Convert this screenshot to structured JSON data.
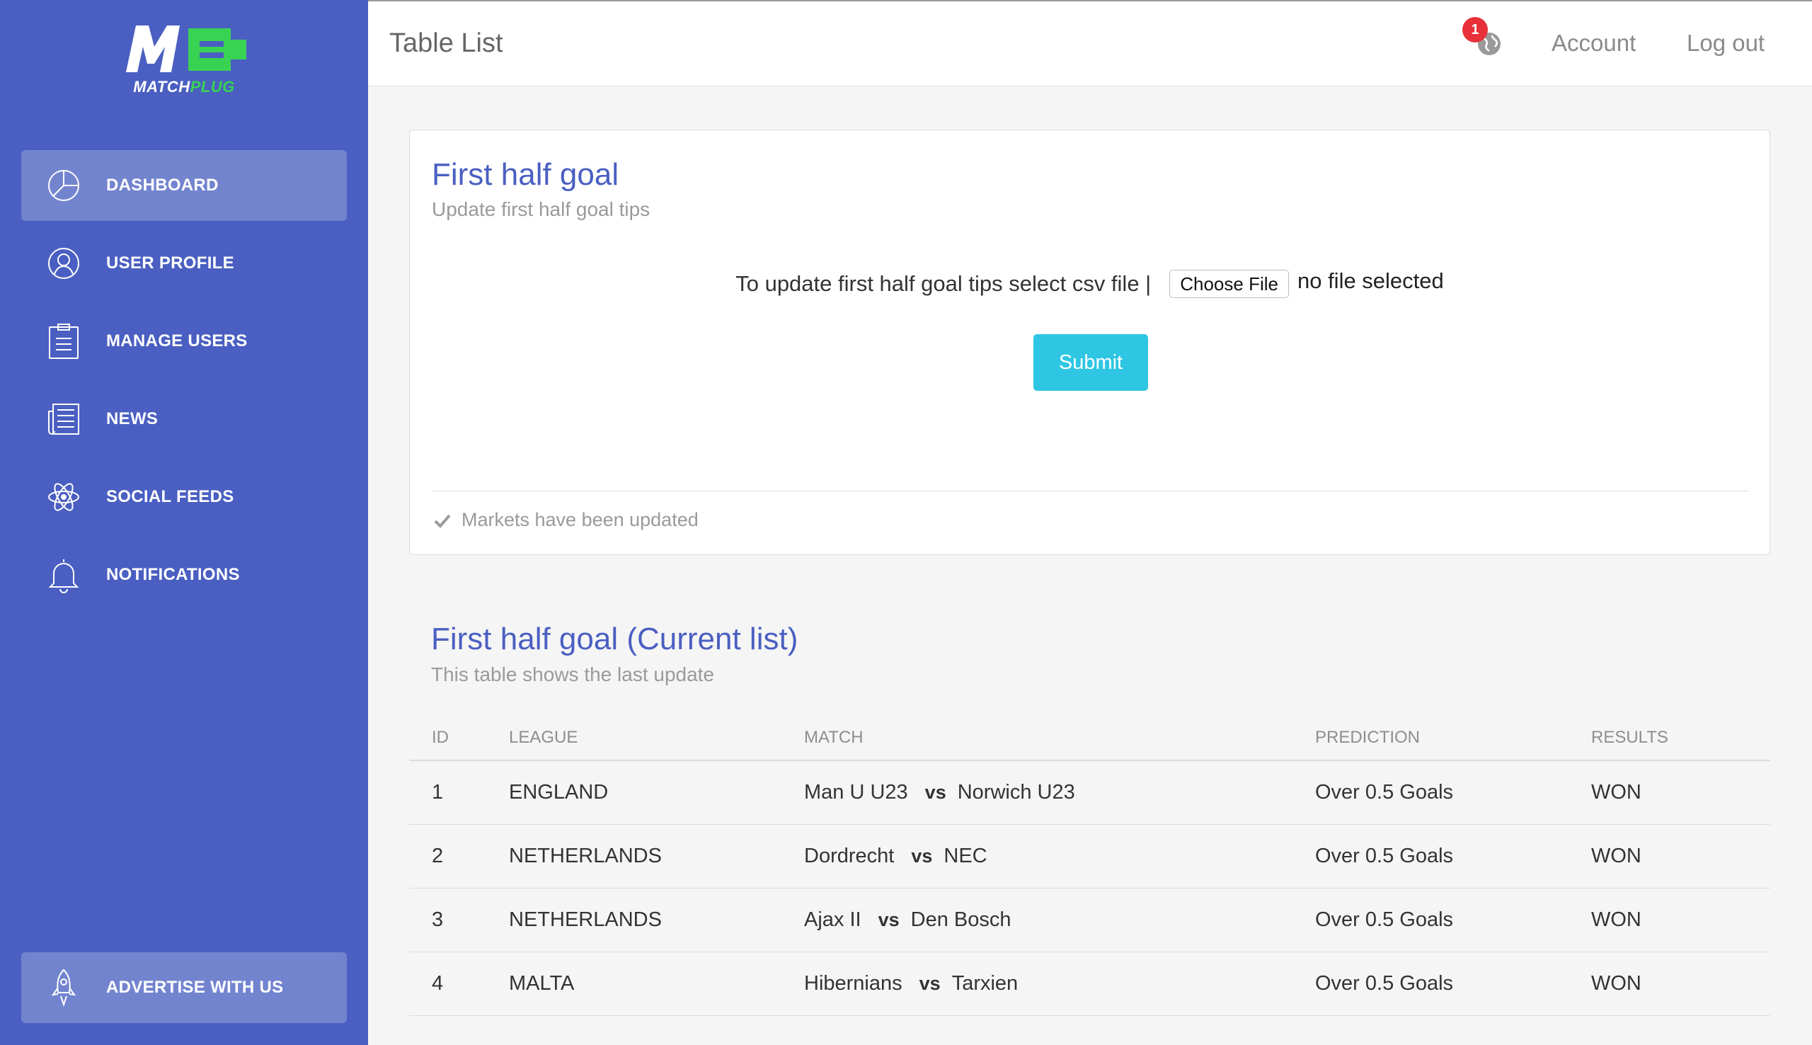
{
  "brand": {
    "logo_primary": "MATCH",
    "logo_secondary": "PLUG",
    "colors": {
      "sidebar": "#4a5fc1",
      "accent_green": "#39d353",
      "submit": "#2ec6e2",
      "badge": "#e8303a"
    }
  },
  "sidebar": {
    "items": [
      {
        "label": "DASHBOARD",
        "icon": "pie-chart-icon",
        "active": true
      },
      {
        "label": "USER PROFILE",
        "icon": "user-icon"
      },
      {
        "label": "MANAGE USERS",
        "icon": "clipboard-icon"
      },
      {
        "label": "NEWS",
        "icon": "newspaper-icon"
      },
      {
        "label": "SOCIAL FEEDS",
        "icon": "atom-icon"
      },
      {
        "label": "NOTIFICATIONS",
        "icon": "bell-icon"
      }
    ],
    "advertise": {
      "label": "ADVERTISE WITH US",
      "icon": "rocket-icon"
    }
  },
  "topbar": {
    "title": "Table List",
    "notification_count": "1",
    "account": "Account",
    "logout": "Log out"
  },
  "upload_card": {
    "title": "First half goal",
    "subtitle": "Update first half goal tips",
    "upload_label": "To update first half goal tips select csv file |",
    "choose_file": "Choose File",
    "file_status": "no file selected",
    "submit": "Submit",
    "footer": "Markets have been updated"
  },
  "table_section": {
    "title": "First half goal (Current list)",
    "subtitle": "This table shows the last update",
    "headers": {
      "id": "ID",
      "league": "LEAGUE",
      "match": "MATCH",
      "prediction": "PREDICTION",
      "results": "RESULTS"
    },
    "vs": "vs",
    "rows": [
      {
        "id": "1",
        "league": "ENGLAND",
        "home": "Man U U23",
        "away": "Norwich U23",
        "prediction": "Over 0.5 Goals",
        "result": "WON"
      },
      {
        "id": "2",
        "league": "NETHERLANDS",
        "home": "Dordrecht",
        "away": "NEC",
        "prediction": "Over 0.5 Goals",
        "result": "WON"
      },
      {
        "id": "3",
        "league": "NETHERLANDS",
        "home": "Ajax II",
        "away": "Den Bosch",
        "prediction": "Over 0.5 Goals",
        "result": "WON"
      },
      {
        "id": "4",
        "league": "MALTA",
        "home": "Hibernians",
        "away": "Tarxien",
        "prediction": "Over 0.5 Goals",
        "result": "WON"
      }
    ]
  }
}
